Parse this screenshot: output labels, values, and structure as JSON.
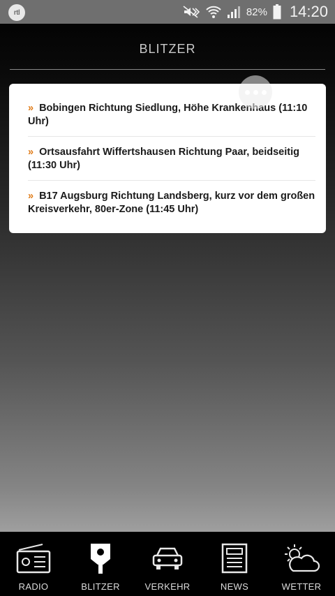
{
  "status_bar": {
    "app_logo_text": "rtl",
    "battery_percent": "82%",
    "time": "14:20",
    "icons": [
      "rtl-logo-icon",
      "mute-icon",
      "wifi-icon",
      "signal-icon",
      "battery-icon"
    ]
  },
  "header": {
    "title": "BLITZER"
  },
  "list": {
    "bullet": "»",
    "items": [
      {
        "text": "Bobingen Richtung Siedlung, Höhe Krankenhaus (11:10 Uhr)"
      },
      {
        "text": "Ortsausfahrt Wiffertshausen Richtung Paar, beidseitig (11:30 Uhr)"
      },
      {
        "text": "B17 Augsburg Richtung Landsberg, kurz vor dem großen Kreisverkehr, 80er-Zone (11:45 Uhr)"
      }
    ]
  },
  "bottom_nav": {
    "items": [
      {
        "label": "RADIO",
        "icon": "radio-icon"
      },
      {
        "label": "BLITZER",
        "icon": "speed-camera-icon"
      },
      {
        "label": "VERKEHR",
        "icon": "car-icon"
      },
      {
        "label": "NEWS",
        "icon": "newspaper-icon"
      },
      {
        "label": "WETTER",
        "icon": "weather-icon"
      }
    ]
  },
  "colors": {
    "accent_bullet": "#e07b17",
    "status_bar": "#6f6f6f",
    "card_background": "#ffffff",
    "nav_background": "#000000"
  }
}
